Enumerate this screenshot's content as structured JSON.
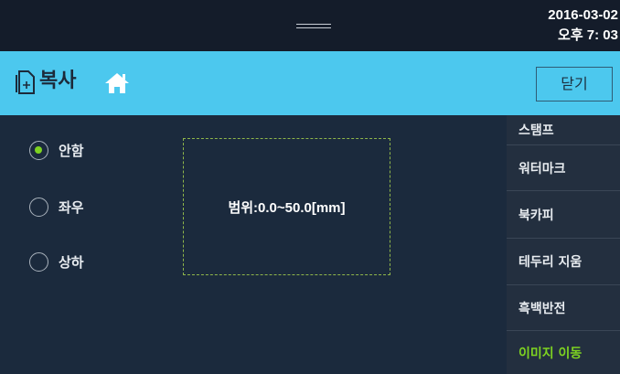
{
  "status": {
    "date": "2016-03-02",
    "time": "오후 7: 03"
  },
  "titlebar": {
    "title": "복사",
    "close_label": "닫기"
  },
  "options": [
    {
      "label": "안함",
      "selected": true
    },
    {
      "label": "좌우",
      "selected": false
    },
    {
      "label": "상하",
      "selected": false
    }
  ],
  "range_text": "범위:0.0~50.0[mm]",
  "menu": [
    {
      "label": "스탬프"
    },
    {
      "label": "워터마크"
    },
    {
      "label": "북카피"
    },
    {
      "label": "테두리 지움"
    },
    {
      "label": "흑백반전"
    },
    {
      "label": "이미지 이동",
      "active": true
    }
  ],
  "colors": {
    "titlebar": "#4cc8ee",
    "background": "#1b2a3d",
    "accent": "#7ed321"
  }
}
